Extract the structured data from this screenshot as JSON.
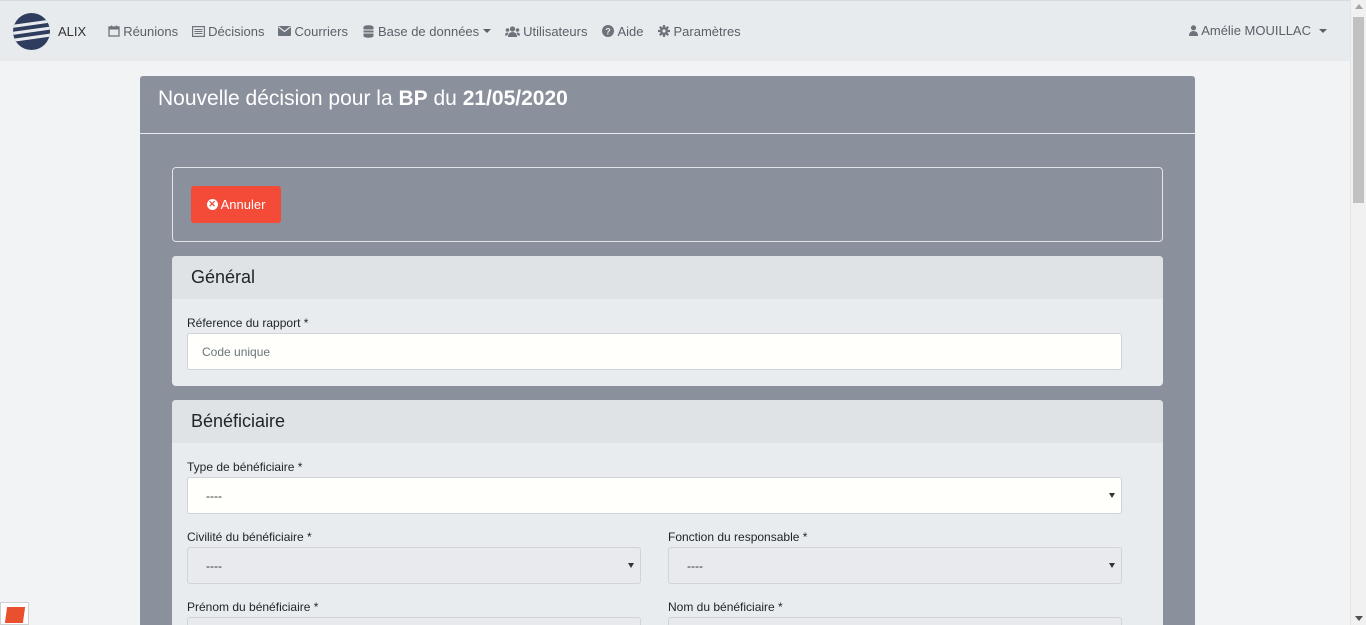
{
  "navbar": {
    "brand": "ALIX",
    "items": [
      {
        "label": "Réunions",
        "icon": "calendar-icon"
      },
      {
        "label": "Décisions",
        "icon": "list-alt-icon"
      },
      {
        "label": "Courriers",
        "icon": "envelope-icon"
      },
      {
        "label": "Base de données",
        "icon": "database-icon",
        "dropdown": true
      },
      {
        "label": "Utilisateurs",
        "icon": "users-icon"
      },
      {
        "label": "Aide",
        "icon": "question-circle-icon"
      },
      {
        "label": "Paramètres",
        "icon": "gear-icon"
      }
    ],
    "user": "Amélie MOUILLAC"
  },
  "page": {
    "title_prefix": "Nouvelle décision pour la ",
    "title_entity": "BP",
    "title_mid": " du ",
    "title_date": "21/05/2020"
  },
  "actions": {
    "cancel_label": "Annuler"
  },
  "general": {
    "heading": "Général",
    "reference_label": "Réference du rapport *",
    "reference_placeholder": "Code unique"
  },
  "beneficiaire": {
    "heading": "Bénéficiaire",
    "type_label": "Type de bénéficiaire *",
    "type_value": "----",
    "civilite_label": "Civilité du bénéficiaire *",
    "civilite_value": "----",
    "fonction_label": "Fonction du responsable *",
    "fonction_value": "----",
    "prenom_label": "Prénom du bénéficiaire *",
    "nom_label": "Nom du bénéficiaire *"
  },
  "colors": {
    "card": "#8a909c",
    "cancel": "#f44b38",
    "navbar": "#e8ebee"
  }
}
